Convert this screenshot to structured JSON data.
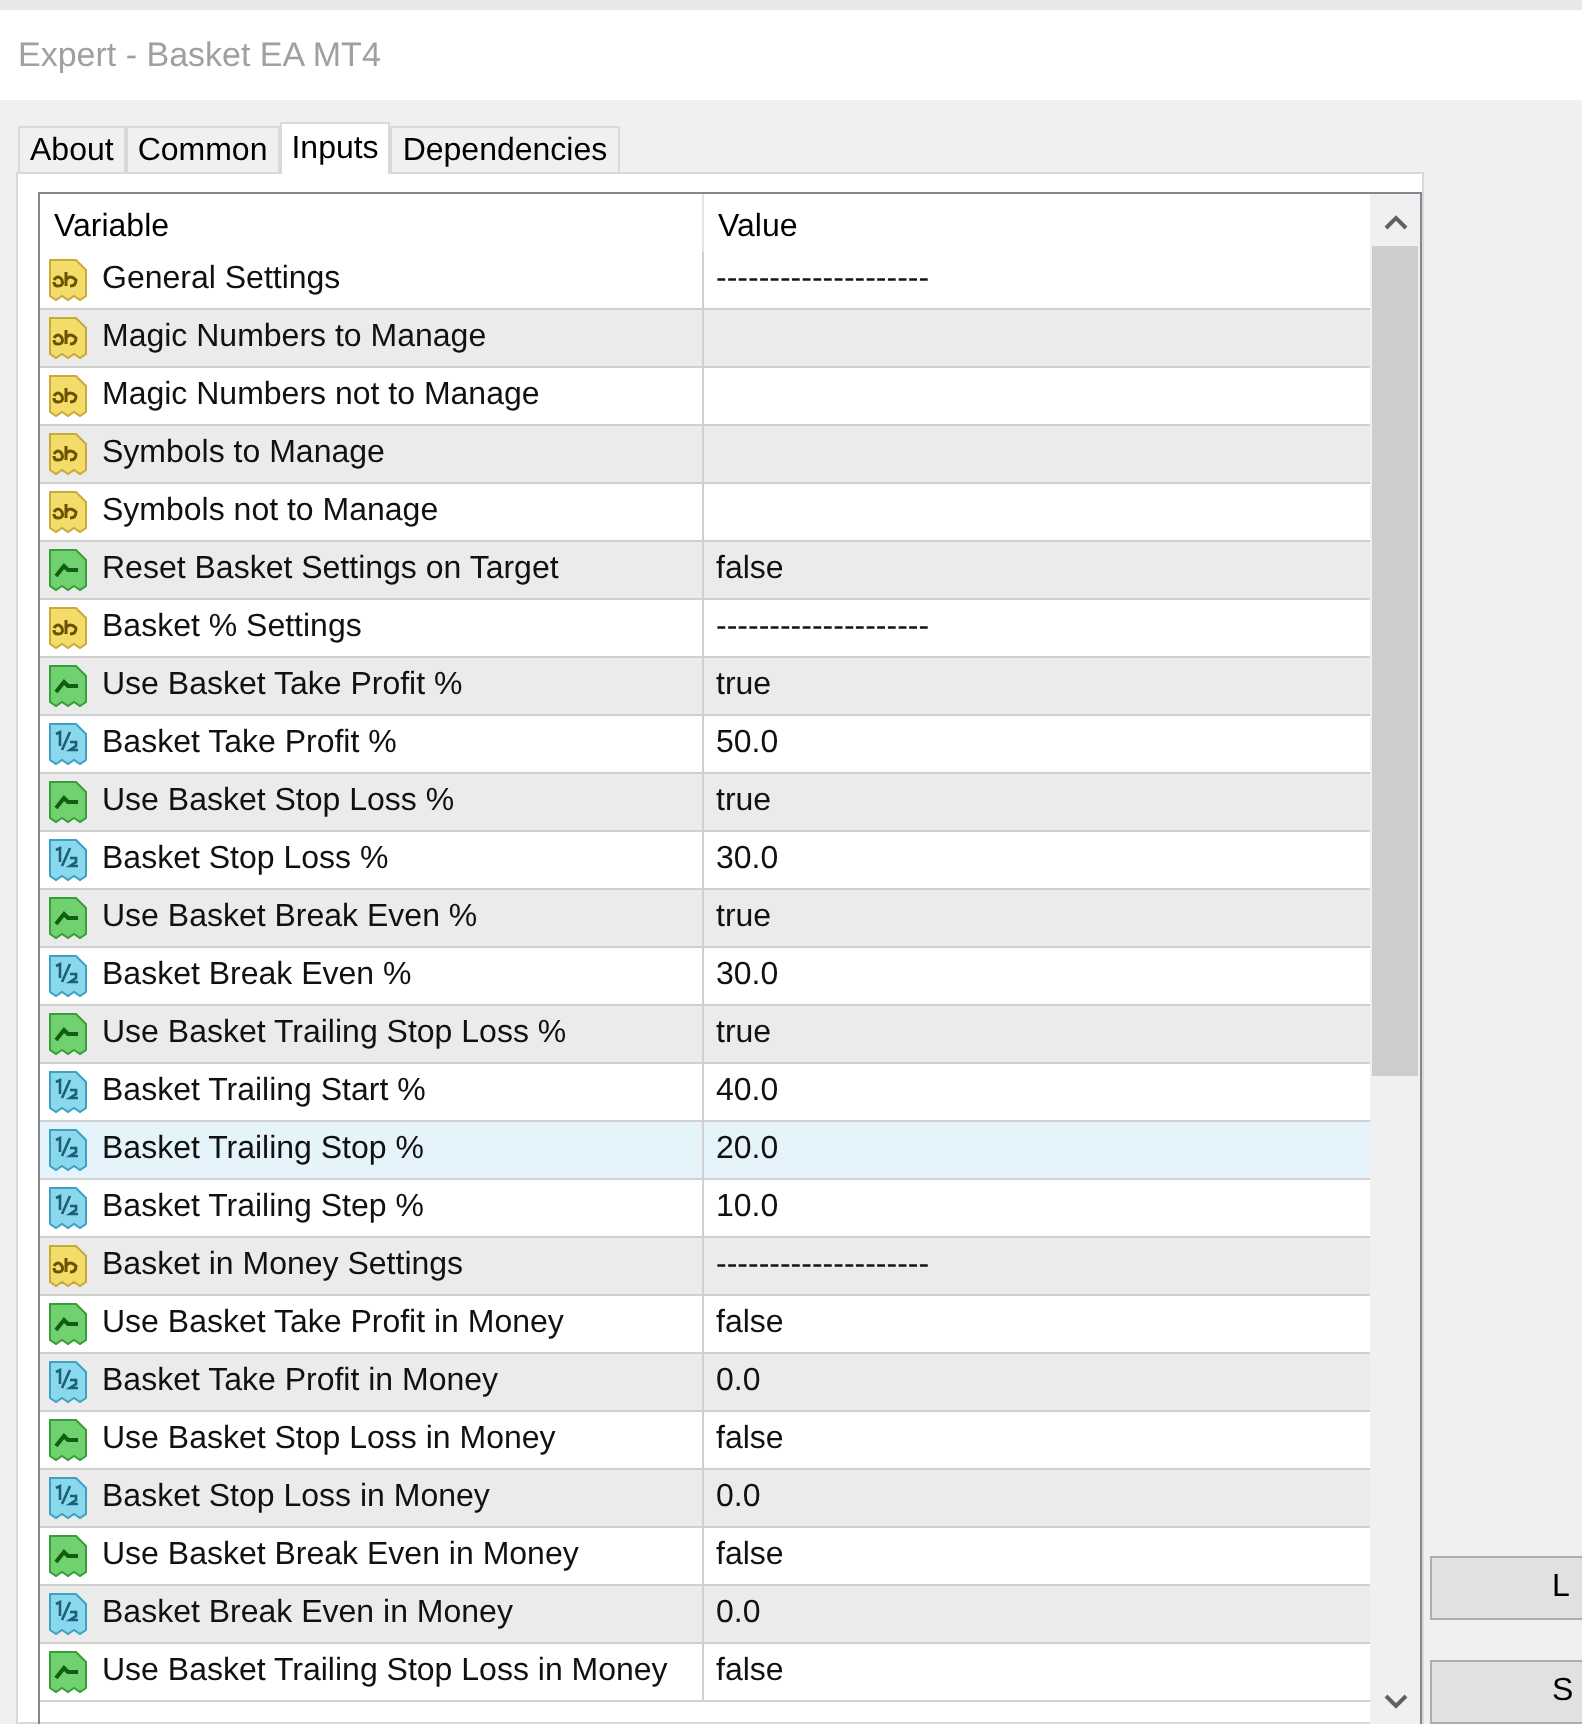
{
  "window": {
    "title": "Expert - Basket EA MT4"
  },
  "tabs": [
    {
      "label": "About",
      "selected": false
    },
    {
      "label": "Common",
      "selected": false
    },
    {
      "label": "Inputs",
      "selected": true
    },
    {
      "label": "Dependencies",
      "selected": false
    }
  ],
  "table": {
    "columns": [
      "Variable",
      "Value"
    ],
    "rows": [
      {
        "kind": "text",
        "variable": "General Settings",
        "value": "--------------------",
        "selected": false
      },
      {
        "kind": "text",
        "variable": "Magic Numbers to Manage",
        "value": "",
        "selected": false
      },
      {
        "kind": "text",
        "variable": "Magic Numbers not to Manage",
        "value": "",
        "selected": false
      },
      {
        "kind": "text",
        "variable": "Symbols to Manage",
        "value": "",
        "selected": false
      },
      {
        "kind": "text",
        "variable": "Symbols not to Manage",
        "value": "",
        "selected": false
      },
      {
        "kind": "bool",
        "variable": "Reset Basket Settings on Target",
        "value": "false",
        "selected": false
      },
      {
        "kind": "text",
        "variable": "Basket % Settings",
        "value": "--------------------",
        "selected": false
      },
      {
        "kind": "bool",
        "variable": "Use Basket Take Profit %",
        "value": "true",
        "selected": false
      },
      {
        "kind": "number",
        "variable": "Basket Take Profit %",
        "value": "50.0",
        "selected": false
      },
      {
        "kind": "bool",
        "variable": "Use Basket Stop Loss %",
        "value": "true",
        "selected": false
      },
      {
        "kind": "number",
        "variable": "Basket Stop Loss %",
        "value": "30.0",
        "selected": false
      },
      {
        "kind": "bool",
        "variable": "Use Basket Break Even %",
        "value": "true",
        "selected": false
      },
      {
        "kind": "number",
        "variable": "Basket Break Even %",
        "value": "30.0",
        "selected": false
      },
      {
        "kind": "bool",
        "variable": "Use Basket Trailing Stop Loss %",
        "value": "true",
        "selected": false
      },
      {
        "kind": "number",
        "variable": "Basket Trailing Start %",
        "value": "40.0",
        "selected": false
      },
      {
        "kind": "number",
        "variable": "Basket Trailing Stop %",
        "value": "20.0",
        "selected": true
      },
      {
        "kind": "number",
        "variable": "Basket Trailing Step %",
        "value": "10.0",
        "selected": false
      },
      {
        "kind": "text",
        "variable": "Basket in Money Settings",
        "value": "--------------------",
        "selected": false
      },
      {
        "kind": "bool",
        "variable": "Use Basket Take Profit in Money",
        "value": "false",
        "selected": false
      },
      {
        "kind": "number",
        "variable": "Basket Take Profit in Money",
        "value": "0.0",
        "selected": false
      },
      {
        "kind": "bool",
        "variable": "Use Basket Stop Loss in Money",
        "value": "false",
        "selected": false
      },
      {
        "kind": "number",
        "variable": "Basket Stop Loss in Money",
        "value": "0.0",
        "selected": false
      },
      {
        "kind": "bool",
        "variable": "Use Basket Break Even in Money",
        "value": "false",
        "selected": false
      },
      {
        "kind": "number",
        "variable": "Basket Break Even in Money",
        "value": "0.0",
        "selected": false
      },
      {
        "kind": "bool",
        "variable": "Use Basket Trailing Stop Loss in Money",
        "value": "false",
        "selected": false
      }
    ]
  },
  "buttons": [
    "L",
    "S"
  ]
}
